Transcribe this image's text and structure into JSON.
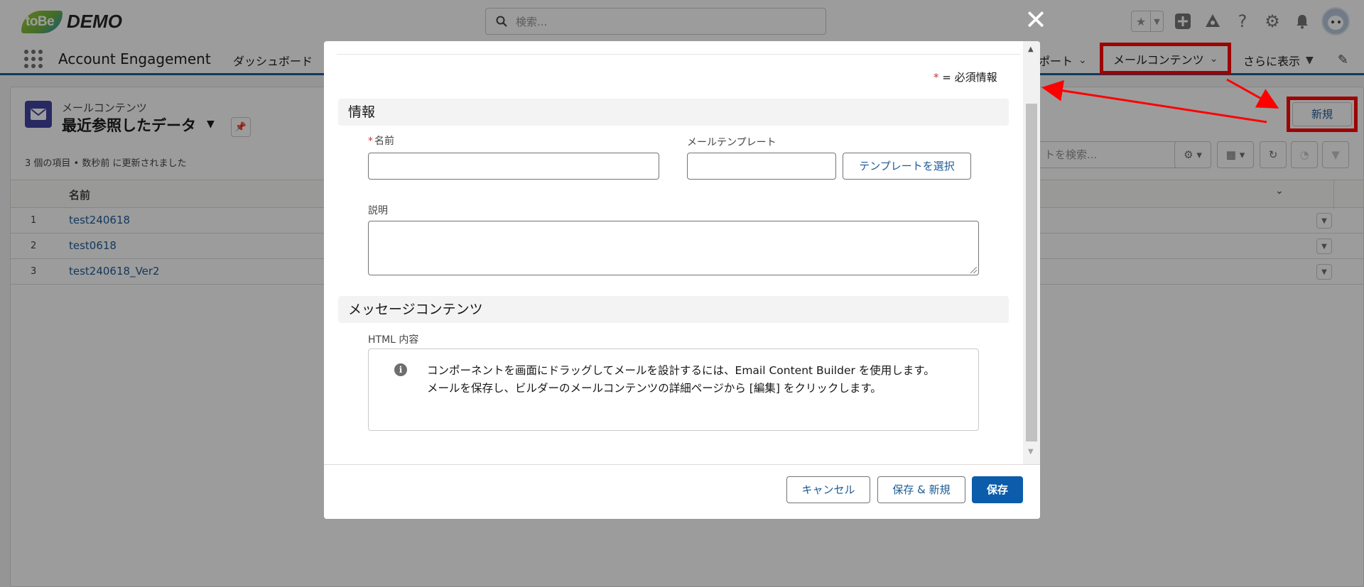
{
  "header": {
    "logo_mark": "toBe",
    "logo_text": "DEMO",
    "search_placeholder": "検索..."
  },
  "nav": {
    "app_name": "Account Engagement",
    "items": [
      {
        "label": "ダッシュボード"
      },
      {
        "label": "ポート"
      },
      {
        "label": "メールコンテンツ"
      },
      {
        "label": "さらに表示"
      }
    ]
  },
  "list": {
    "object_label": "メールコンテンツ",
    "view_name": "最近参照したデータ",
    "meta": "3 個の項目 • 数秒前 に更新されました",
    "new_button": "新規",
    "search_placeholder": "トを検索...",
    "column_name": "名前",
    "rows": [
      {
        "num": "1",
        "name": "test240618"
      },
      {
        "num": "2",
        "name": "test0618"
      },
      {
        "num": "3",
        "name": "test240618_Ver2"
      }
    ]
  },
  "modal": {
    "required_note_star": "*",
    "required_note_text": " = 必須情報",
    "section_info": "情報",
    "field_name_label": "名前",
    "field_template_label": "メールテンプレート",
    "select_template_button": "テンプレートを選択",
    "field_description_label": "説明",
    "section_message": "メッセージコンテンツ",
    "html_content_label": "HTML 内容",
    "info_line1": "コンポーネントを画面にドラッグしてメールを設計するには、Email Content Builder を使用します。",
    "info_line2": "メールを保存し、ビルダーのメールコンテンツの詳細ページから [編集] をクリックします。",
    "cancel_button": "キャンセル",
    "save_new_button": "保存 & 新規",
    "save_button": "保存"
  },
  "colors": {
    "brand": "#0b5cab",
    "annotation_red": "#ff0000",
    "link": "#1b5a96"
  }
}
